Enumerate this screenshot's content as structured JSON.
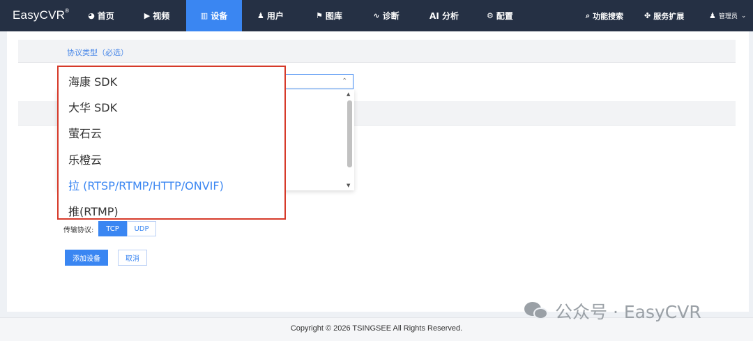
{
  "nav": {
    "logo": "EasyCVR",
    "logo_mark": "®",
    "items": [
      {
        "label": "首页",
        "icon": "dashboard-icon",
        "glyph": "◕"
      },
      {
        "label": "视频",
        "icon": "play-icon",
        "glyph": "▶"
      },
      {
        "label": "设备",
        "icon": "device-icon",
        "glyph": "▥"
      },
      {
        "label": "用户",
        "icon": "user-icon",
        "glyph": "♟"
      },
      {
        "label": "图库",
        "icon": "gallery-icon",
        "glyph": "⚑"
      },
      {
        "label": "诊断",
        "icon": "pulse-icon",
        "glyph": "∿"
      },
      {
        "label": "AI 分析",
        "icon": "",
        "glyph": ""
      },
      {
        "label": "配置",
        "icon": "gear-icon",
        "glyph": "⚙"
      }
    ],
    "active_index": 2,
    "search_label": "功能搜索",
    "search_glyph": "⌕",
    "extension_label": "服务扩展",
    "extension_glyph": "✤",
    "user_label": "管理员",
    "user_glyph": "♟",
    "user_caret": "⌄"
  },
  "form": {
    "protocol_section_label": "协议类型（必选）",
    "select_arrow": "⌃",
    "dropdown_options": [
      "海康 SDK",
      "大华 SDK",
      "萤石云",
      "乐橙云",
      "拉 (RTSP/RTMP/HTTP/ONVIF)",
      "推(RTMP)"
    ],
    "selected_option": "拉 (RTSP/RTMP/HTTP/ONVIF)",
    "transport_label": "传输协议:",
    "tcp_label": "TCP",
    "udp_label": "UDP",
    "add_button": "添加设备",
    "cancel_button": "取消"
  },
  "footer": {
    "copyright": "Copyright © 2026 TSINGSEE All Rights Reserved."
  },
  "watermark": {
    "text": "公众号 · EasyCVR"
  },
  "colors": {
    "nav_bg": "#253044",
    "accent": "#3a86f2",
    "highlight_border": "#d63a2a"
  }
}
